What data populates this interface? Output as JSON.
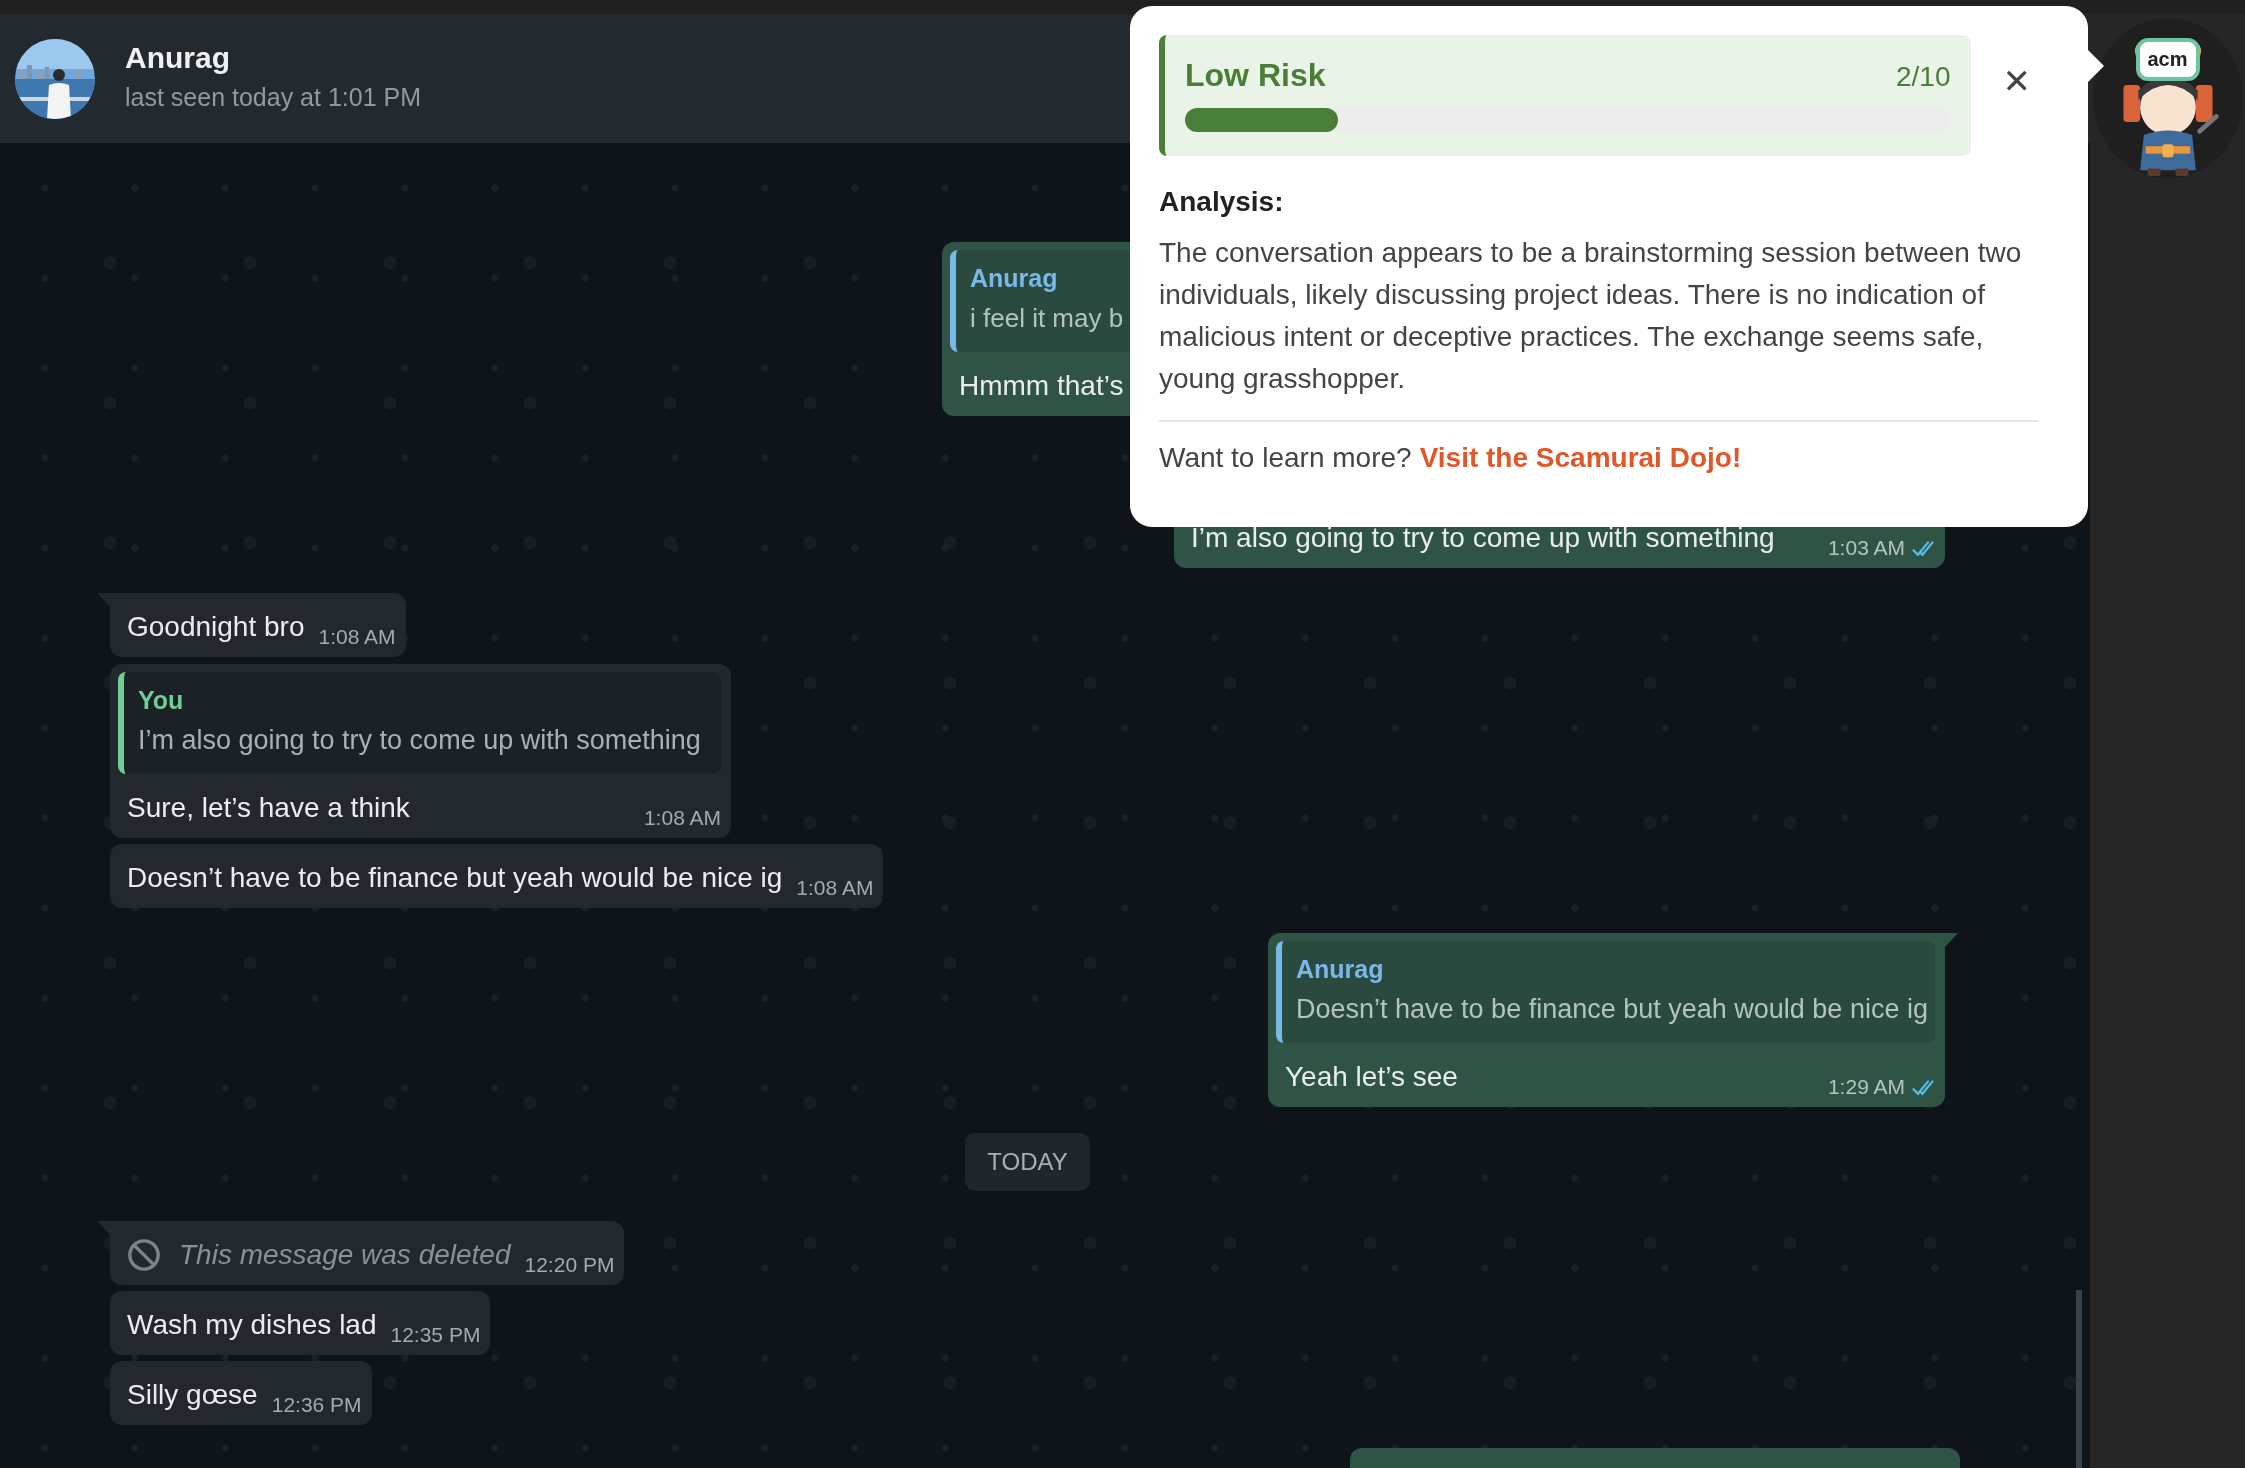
{
  "header": {
    "name": "Anurag",
    "status": "last seen today at 1:01 PM"
  },
  "messages": [
    {
      "kind": "text",
      "outgoing": true,
      "quote": {
        "author": "Anurag",
        "text": "i feel it may b",
        "color": "#7ab8e8"
      },
      "text": "Hmmm that’s"
    },
    {
      "kind": "text",
      "outgoing": true,
      "text": "I’m also going to try to come up with something",
      "time": "1:03 AM",
      "read": true
    },
    {
      "kind": "text",
      "outgoing": false,
      "tail": true,
      "text": "Goodnight bro",
      "time": "1:08 AM"
    },
    {
      "kind": "text",
      "outgoing": false,
      "quote": {
        "author": "You",
        "text": "I’m also going to try to come up with something",
        "color": "#6fcf97"
      },
      "text": "Sure, let’s have a think",
      "time": "1:08 AM"
    },
    {
      "kind": "text",
      "outgoing": false,
      "text": "Doesn’t have to be finance but yeah would be nice ig",
      "time": "1:08 AM"
    },
    {
      "kind": "text",
      "outgoing": true,
      "tail": true,
      "quote": {
        "author": "Anurag",
        "text": "Doesn’t have to be finance but yeah would be nice ig",
        "color": "#7ab8e8"
      },
      "text": "Yeah let’s see",
      "time": "1:29 AM",
      "read": true
    },
    {
      "kind": "date",
      "text": "TODAY"
    },
    {
      "kind": "deleted",
      "outgoing": false,
      "tail": true,
      "text": "This message was deleted",
      "time": "12:20 PM"
    },
    {
      "kind": "text",
      "outgoing": false,
      "text": "Wash my dishes lad",
      "time": "12:35 PM"
    },
    {
      "kind": "text",
      "outgoing": false,
      "text": "Silly gœse",
      "time": "12:36 PM"
    },
    {
      "kind": "partial",
      "outgoing": true
    }
  ],
  "popup": {
    "risk_label": "Low Risk",
    "score": "2/10",
    "level": 0.2,
    "close": "✕",
    "heading": "Analysis:",
    "analysis": "The conversation appears to be a brainstorming session between two individuals, likely discussing project ideas. There is no indication of malicious intent or deceptive practices. The exchange seems safe, young grasshopper.",
    "footer_text": "Want to learn more?",
    "link": "Visit the Scamurai Dojo!"
  },
  "mascot": {
    "badge": "acm"
  }
}
